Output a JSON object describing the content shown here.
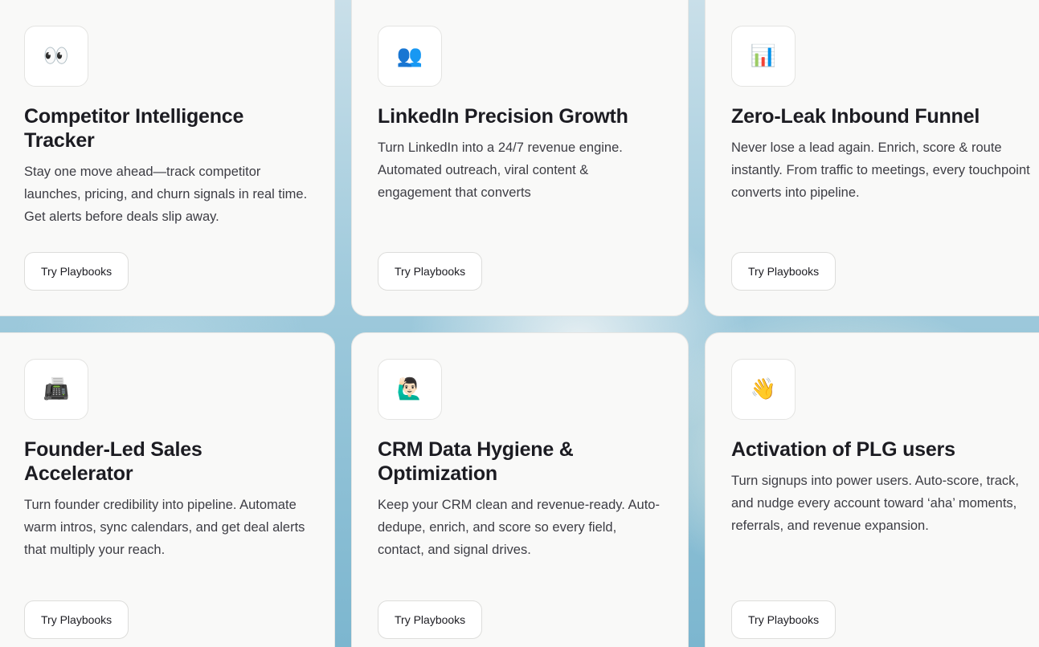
{
  "cards": [
    {
      "icon": "👀",
      "icon_name": "eyes-icon",
      "title": "Competitor Intelligence Tracker",
      "description": "Stay one move ahead—track competitor launches, pricing, and churn signals in real time. Get alerts before deals slip away.",
      "cta": "Try Playbooks"
    },
    {
      "icon": "👥",
      "icon_name": "people-icon",
      "title": "LinkedIn Precision Growth",
      "description": "Turn LinkedIn into a 24/7 revenue engine. Automated outreach, viral content & engagement that converts",
      "cta": "Try Playbooks"
    },
    {
      "icon": "📊",
      "icon_name": "bar-chart-icon",
      "title": "Zero-Leak Inbound Funnel",
      "description": "Never lose a lead again. Enrich, score & route instantly. From traffic to meetings, every touchpoint converts into pipeline.",
      "cta": "Try Playbooks"
    },
    {
      "icon": "📠",
      "icon_name": "fax-machine-icon",
      "title": "Founder-Led Sales Accelerator",
      "description": "Turn founder credibility into pipeline. Automate warm intros, sync calendars, and get deal alerts that multiply your reach.",
      "cta": "Try Playbooks"
    },
    {
      "icon": "🙋🏻‍♂️",
      "icon_name": "raising-hand-icon",
      "title": "CRM Data Hygiene & Optimization",
      "description": "Keep your CRM clean and revenue-ready. Auto-dedupe, enrich, and score so every field, contact, and signal drives.",
      "cta": "Try Playbooks"
    },
    {
      "icon": "👋",
      "icon_name": "waving-hand-icon",
      "title": "Activation of PLG users",
      "description": "Turn signups into power users. Auto-score, track, and nudge every account toward ‘aha’ moments, referrals, and revenue expansion.",
      "cta": "Try Playbooks"
    }
  ]
}
